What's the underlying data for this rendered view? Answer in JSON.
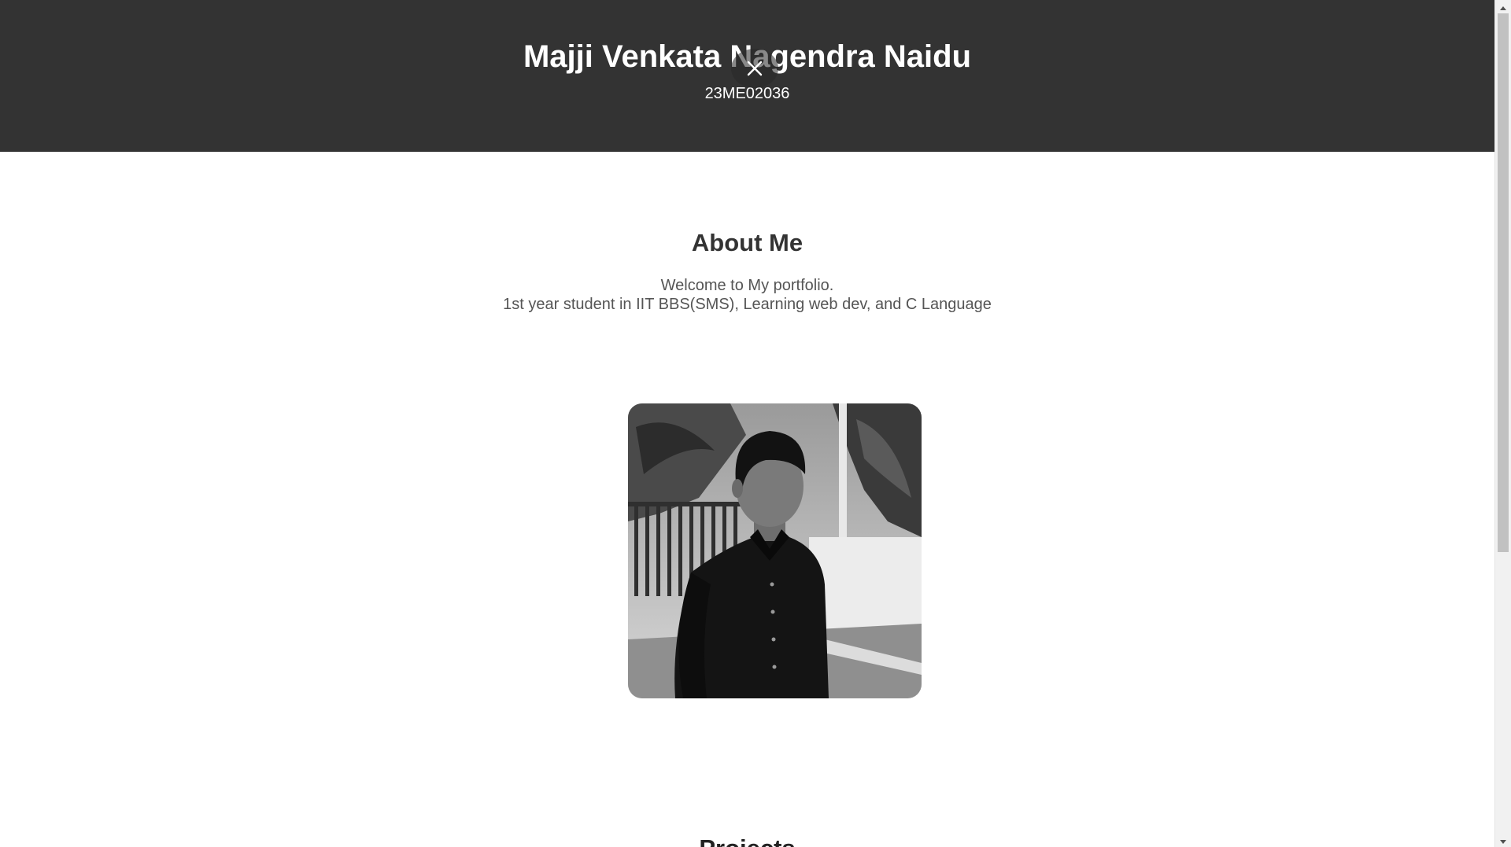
{
  "header": {
    "title": "Majji Venkata Nagendra Naidu",
    "subtitle": "23ME02036"
  },
  "about": {
    "heading": "About Me",
    "line1": "Welcome to My portfolio.",
    "line2": "1st year student in IIT BBS(SMS), Learning web dev, and C Language"
  },
  "projects": {
    "heading": "Projects"
  },
  "icons": {
    "close": "close-icon",
    "scroll_up": "scroll-up-arrow-icon",
    "scroll_down": "scroll-down-arrow-icon"
  },
  "colors": {
    "header_bg": "#333333",
    "header_text": "#ffffff",
    "heading_text": "#333333",
    "body_text": "#555555"
  }
}
